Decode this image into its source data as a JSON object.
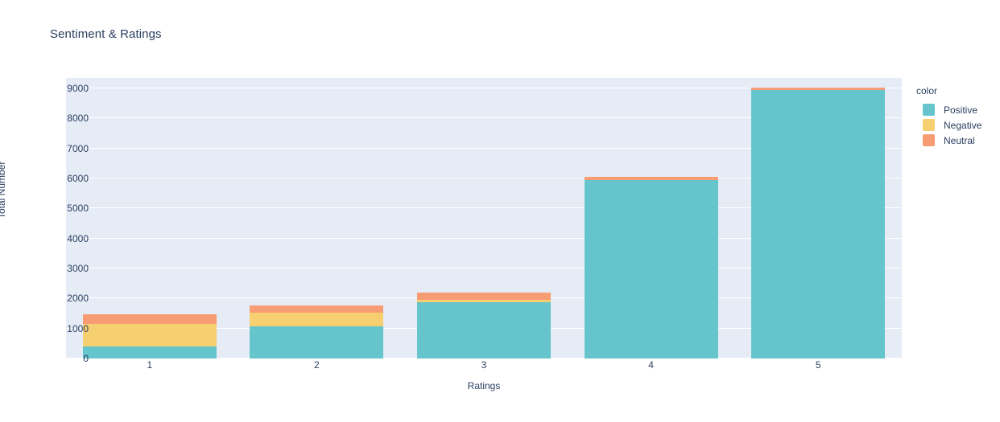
{
  "chart_data": {
    "type": "bar",
    "barmode": "stacked",
    "title": "Sentiment & Ratings",
    "xlabel": "Ratings",
    "ylabel": "Total Number",
    "categories": [
      "1",
      "2",
      "3",
      "4",
      "5"
    ],
    "series": [
      {
        "name": "Positive",
        "color": "#66c5cc",
        "values": [
          400,
          1080,
          1870,
          5950,
          8950
        ]
      },
      {
        "name": "Negative",
        "color": "#f6cf71",
        "values": [
          750,
          440,
          80,
          0,
          0
        ]
      },
      {
        "name": "Neutral",
        "color": "#f89c74",
        "values": [
          320,
          240,
          250,
          110,
          80
        ]
      }
    ],
    "totals": [
      1470,
      1760,
      2200,
      6060,
      9030
    ],
    "ylim": [
      0,
      9350
    ],
    "yticks": [
      0,
      1000,
      2000,
      3000,
      4000,
      5000,
      6000,
      7000,
      8000,
      9000
    ],
    "ytick_labels": [
      "0",
      "1000",
      "2000",
      "3000",
      "4000",
      "5000",
      "6000",
      "7000",
      "8000",
      "9000"
    ],
    "grid": true,
    "legend": {
      "title": "color",
      "position": "right",
      "entries": [
        {
          "label": "Positive",
          "color": "#66c5cc"
        },
        {
          "label": "Negative",
          "color": "#f6cf71"
        },
        {
          "label": "Neutral",
          "color": "#f89c74"
        }
      ]
    },
    "plot_background": "#e5ecf6",
    "paper_background": "#ffffff",
    "text_color": "#2a3f5f"
  }
}
